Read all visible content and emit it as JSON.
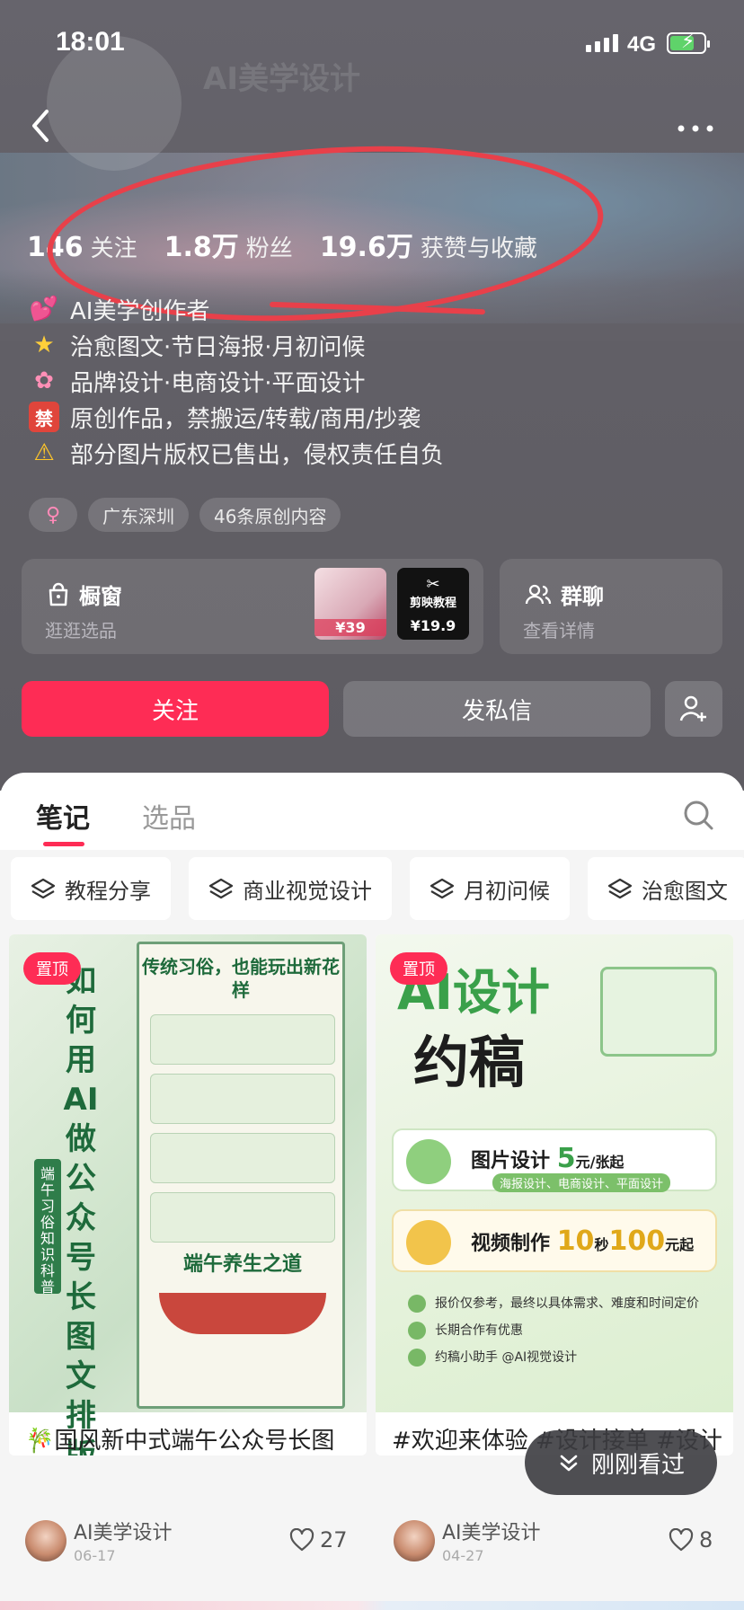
{
  "status_bar": {
    "time": "18:01",
    "network": "4G"
  },
  "profile": {
    "ghost_title": "AI美学设计",
    "stats": [
      {
        "num": "146",
        "label": "关注"
      },
      {
        "num": "1.8万",
        "label": "粉丝"
      },
      {
        "num": "19.6万",
        "label": "获赞与收藏"
      }
    ],
    "bio": [
      {
        "icon": "two-hearts-icon",
        "text": "AI美学创作者"
      },
      {
        "icon": "star-icon",
        "text": "治愈图文·节日海报·月初问候"
      },
      {
        "icon": "flower-icon",
        "text": "品牌设计·电商设计·平面设计"
      },
      {
        "icon": "ban-icon",
        "glyph": "禁",
        "text": "原创作品，禁搬运/转载/商用/抄袭"
      },
      {
        "icon": "warning-icon",
        "text": "部分图片版权已售出，侵权责任自负"
      }
    ],
    "tags": {
      "gender": "♀",
      "location": "广东深圳",
      "original_count": "46条原创内容"
    }
  },
  "shop_card": {
    "title": "橱窗",
    "subtitle": "逛逛选品",
    "thumb1_price": "¥39",
    "thumb2_head": "剪映",
    "thumb2_label": "剪映教程",
    "thumb2_price": "¥19.9"
  },
  "group_card": {
    "title": "群聊",
    "subtitle": "查看详情"
  },
  "actions": {
    "follow": "关注",
    "message": "发私信"
  },
  "tabs": [
    {
      "label": "笔记",
      "active": true
    },
    {
      "label": "选品",
      "active": false
    }
  ],
  "chips": [
    "教程分享",
    "商业视觉设计",
    "月初问候",
    "治愈图文"
  ],
  "notes": [
    {
      "pinned": "置顶",
      "title": "🎋国风新中式端午公众号长图设计 附教程",
      "author": "AI美学设计",
      "date": "06-17",
      "likes": "27",
      "poster": {
        "vertical_text": "如何用AI做公众号长图文排版设计",
        "side_label": "端午习俗知识科普",
        "panel_title": "传统习俗，也能玩出新花样",
        "section2": "端午养生之道"
      }
    },
    {
      "pinned": "置顶",
      "title": "#欢迎来体验 #设计接单 #设计报价 #接单",
      "author": "AI美学设计",
      "date": "04-27",
      "likes": "8",
      "poster": {
        "h1": "AI设计",
        "h2": "约稿",
        "row1_label": "图片设计",
        "row1_num": "5",
        "row1_unit": "元/张起",
        "row1_sub": "海报设计、电商设计、平面设计",
        "row2_label": "视频制作",
        "row2_num": "10",
        "row2_mid": "秒",
        "row2_num2": "100",
        "row2_unit": "元起",
        "list": [
          "报价仅参考，最终以具体需求、难度和时间定价",
          "长期合作有优惠",
          "约稿小助手 @AI视觉设计"
        ]
      }
    }
  ],
  "floating": {
    "label": "刚刚看过"
  },
  "colors": {
    "accent": "#fe2c55",
    "annotation": "#e8404a"
  }
}
